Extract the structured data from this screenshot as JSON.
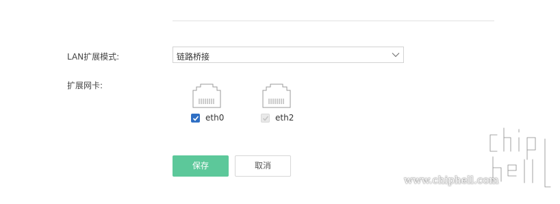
{
  "form": {
    "mode_label": "LAN扩展模式:",
    "mode_value": "链路桥接",
    "nic_label": "扩展网卡:"
  },
  "nics": [
    {
      "name": "eth0",
      "checked": true,
      "disabled": false
    },
    {
      "name": "eth2",
      "checked": true,
      "disabled": true
    }
  ],
  "actions": {
    "save_label": "保存",
    "cancel_label": "取消"
  },
  "watermark": {
    "url_text": "www.chiphell.com",
    "logo_text": "chiphell"
  },
  "colors": {
    "primary_button": "#5cc89a",
    "checkbox_checked": "#2f6fc4",
    "checkbox_disabled": "#e9e9e9"
  },
  "icons": {
    "select_chevron": "chevron-down-icon",
    "nic_port": "ethernet-port-icon",
    "checkbox_check": "check-icon"
  }
}
